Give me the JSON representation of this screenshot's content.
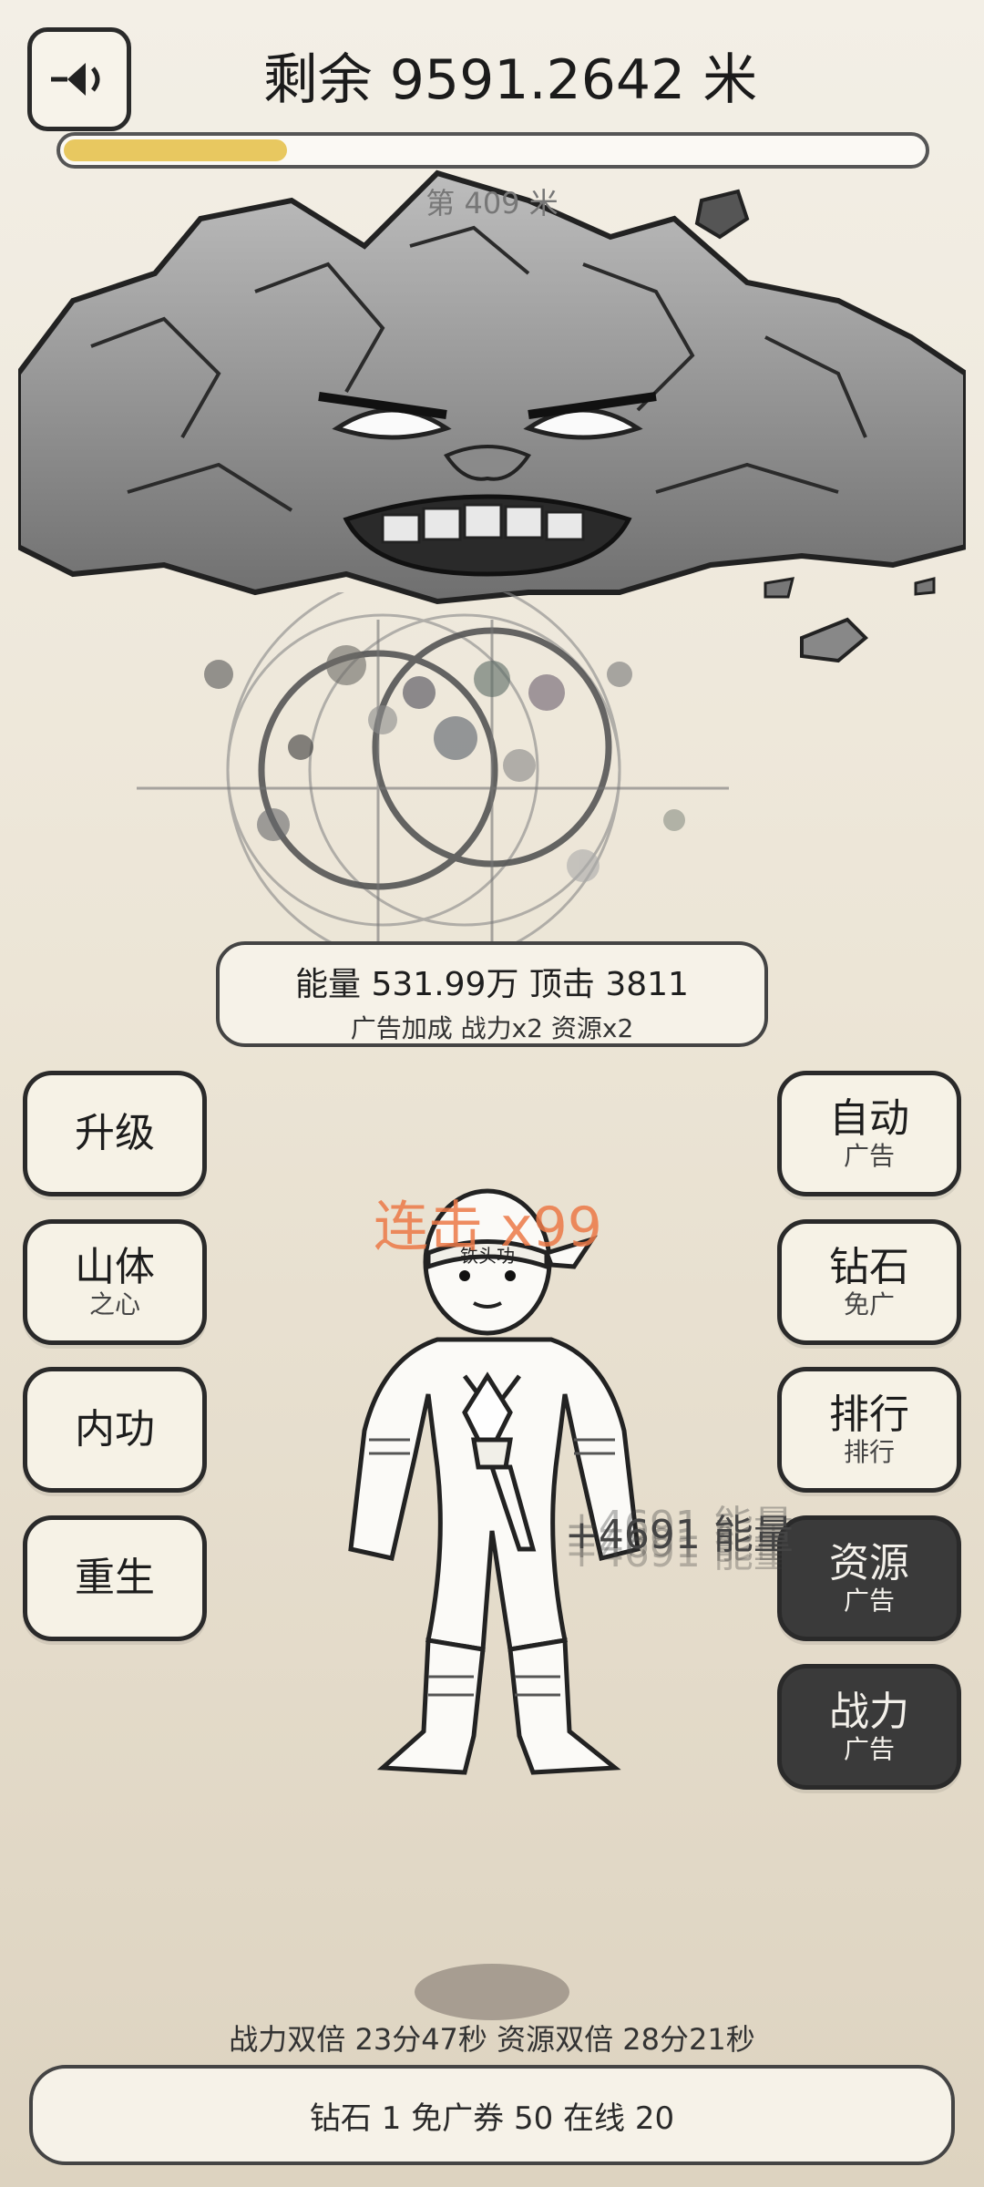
{
  "header": {
    "title": "剩余 9591.2642 米",
    "progress_fraction": 0.26,
    "sub_level": "第 409 米"
  },
  "stats": {
    "line1": "能量 531.99万   顶击 3811",
    "line2": "广告加成  战力x2  资源x2"
  },
  "left_buttons": [
    {
      "main": "升级",
      "sub": ""
    },
    {
      "main": "山体",
      "sub": "之心"
    },
    {
      "main": "内功",
      "sub": ""
    },
    {
      "main": "重生",
      "sub": ""
    }
  ],
  "right_buttons": [
    {
      "main": "自动",
      "sub": "广告"
    },
    {
      "main": "钻石",
      "sub": "免广"
    },
    {
      "main": "排行",
      "sub": "排行"
    },
    {
      "main": "资源",
      "sub": "广告"
    },
    {
      "main": "战力",
      "sub": "广告"
    }
  ],
  "combo": "连击 x99",
  "float_energy": "+4691 能量",
  "timers": "战力双倍 23分47秒  资源双倍 28分21秒",
  "footer": "钻石 1   免广券 50   在线 20",
  "icons": {
    "sound": "sound-icon"
  },
  "colors": {
    "progress": "#e8c860",
    "combo": "#eb7846",
    "dark_button": "#3a3a3a"
  }
}
